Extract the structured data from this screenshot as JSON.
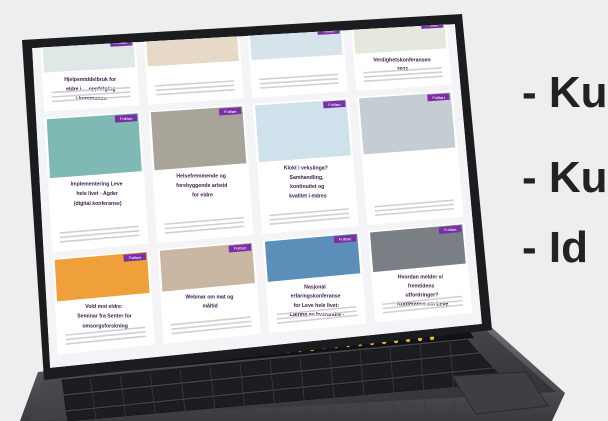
{
  "bullets": [
    "- Ku",
    "- Ku",
    "- Id"
  ],
  "cards": [
    {
      "badge": "Fullført",
      "title": "Hjelpemiddelbruk for eldre i ... oppfølging i kommunen",
      "text": ""
    },
    {
      "badge": "",
      "title": "",
      "text": ""
    },
    {
      "badge": "Fullført",
      "title": "",
      "text": ""
    },
    {
      "badge": "Fullført",
      "title": "Verdighetskonferansen 2021",
      "text": ""
    },
    {
      "badge": "Fullført",
      "title": "Implementering Leve hele livet - Agder (digital konferanse)",
      "text": ""
    },
    {
      "badge": "Fullført",
      "title": "Helsefremmende og forebyggende arbeid for eldre",
      "text": ""
    },
    {
      "badge": "Fullført",
      "title": "Klokt i vekslinga? Samhandling, kontinuitet og kvalitet i eldres tjenesteforløp",
      "text": ""
    },
    {
      "badge": "Fullført",
      "title": "",
      "text": ""
    },
    {
      "badge": "Fullført",
      "title": "Vold mot eldre: Seminar fra Senter for omsorgsforskning",
      "text": ""
    },
    {
      "badge": "Fullført",
      "title": "Webinar om mat og måltid",
      "text": ""
    },
    {
      "badge": "Fullført",
      "title": "Nasjonal erfaringskonferanse for Leve hele livet: Læring av hverandre - hva virker?",
      "text": ""
    },
    {
      "badge": "Fullført",
      "title": "Hvordan melder vi fremtidens utfordringer? Konferanse om Leve hele livet og helsefellesskapene",
      "text": ""
    }
  ],
  "colors": {
    "accent": "#7b2fa7",
    "background": "#eeeeef",
    "laptop": "#2b2c30",
    "screen_bg": "#f4f4f6"
  }
}
